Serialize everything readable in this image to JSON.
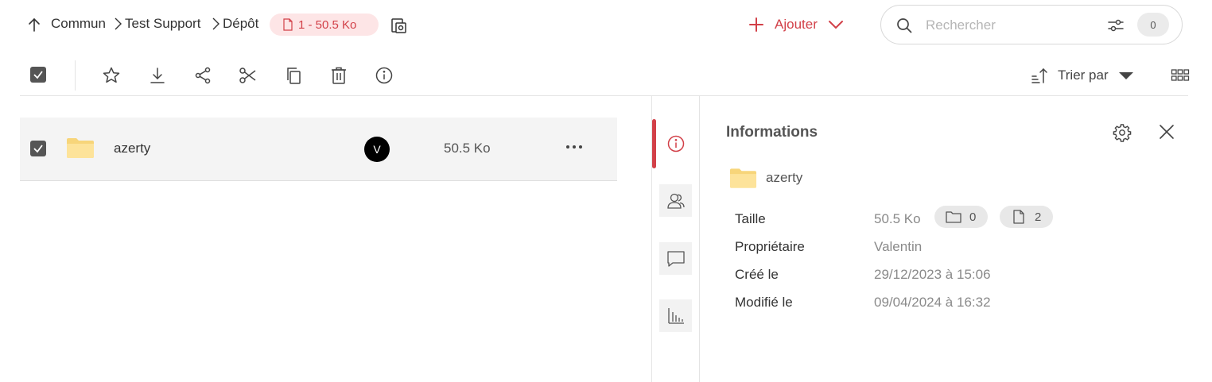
{
  "header": {
    "breadcrumbs": [
      "Commun",
      "Test Support",
      "Dépôt"
    ],
    "selection_badge": "1 - 50.5 Ko",
    "add_label": "Ajouter",
    "search_placeholder": "Rechercher",
    "filter_count": "0"
  },
  "toolbar": {
    "sort_label": "Trier par"
  },
  "files": [
    {
      "name": "azerty",
      "owner_initial": "V",
      "size": "50.5 Ko",
      "selected": true
    }
  ],
  "info": {
    "title": "Informations",
    "name": "azerty",
    "labels": {
      "size": "Taille",
      "owner": "Propriétaire",
      "created": "Créé le",
      "modified": "Modifié le"
    },
    "size": "50.5 Ko",
    "folder_count": "0",
    "file_count": "2",
    "owner": "Valentin",
    "created": "29/12/2023 à 15:06",
    "modified": "09/04/2024 à 16:32"
  },
  "colors": {
    "accent": "#d24048",
    "badge_bg": "#fde5e6",
    "folder": "#fde39a",
    "row_bg": "#f4f4f4"
  },
  "icons": [
    "up-arrow-icon",
    "chevron-right-icon",
    "file-icon",
    "paste-icon",
    "plus-icon",
    "chevron-down-icon",
    "search-icon",
    "filter-icon",
    "checkbox-icon",
    "star-icon",
    "download-icon",
    "share-icon",
    "scissors-icon",
    "copy-icon",
    "trash-icon",
    "info-icon",
    "sort-icon",
    "caret-down-icon",
    "grid-icon",
    "folder-icon",
    "more-icon",
    "users-icon",
    "comment-icon",
    "chart-icon",
    "gear-icon",
    "close-icon"
  ]
}
